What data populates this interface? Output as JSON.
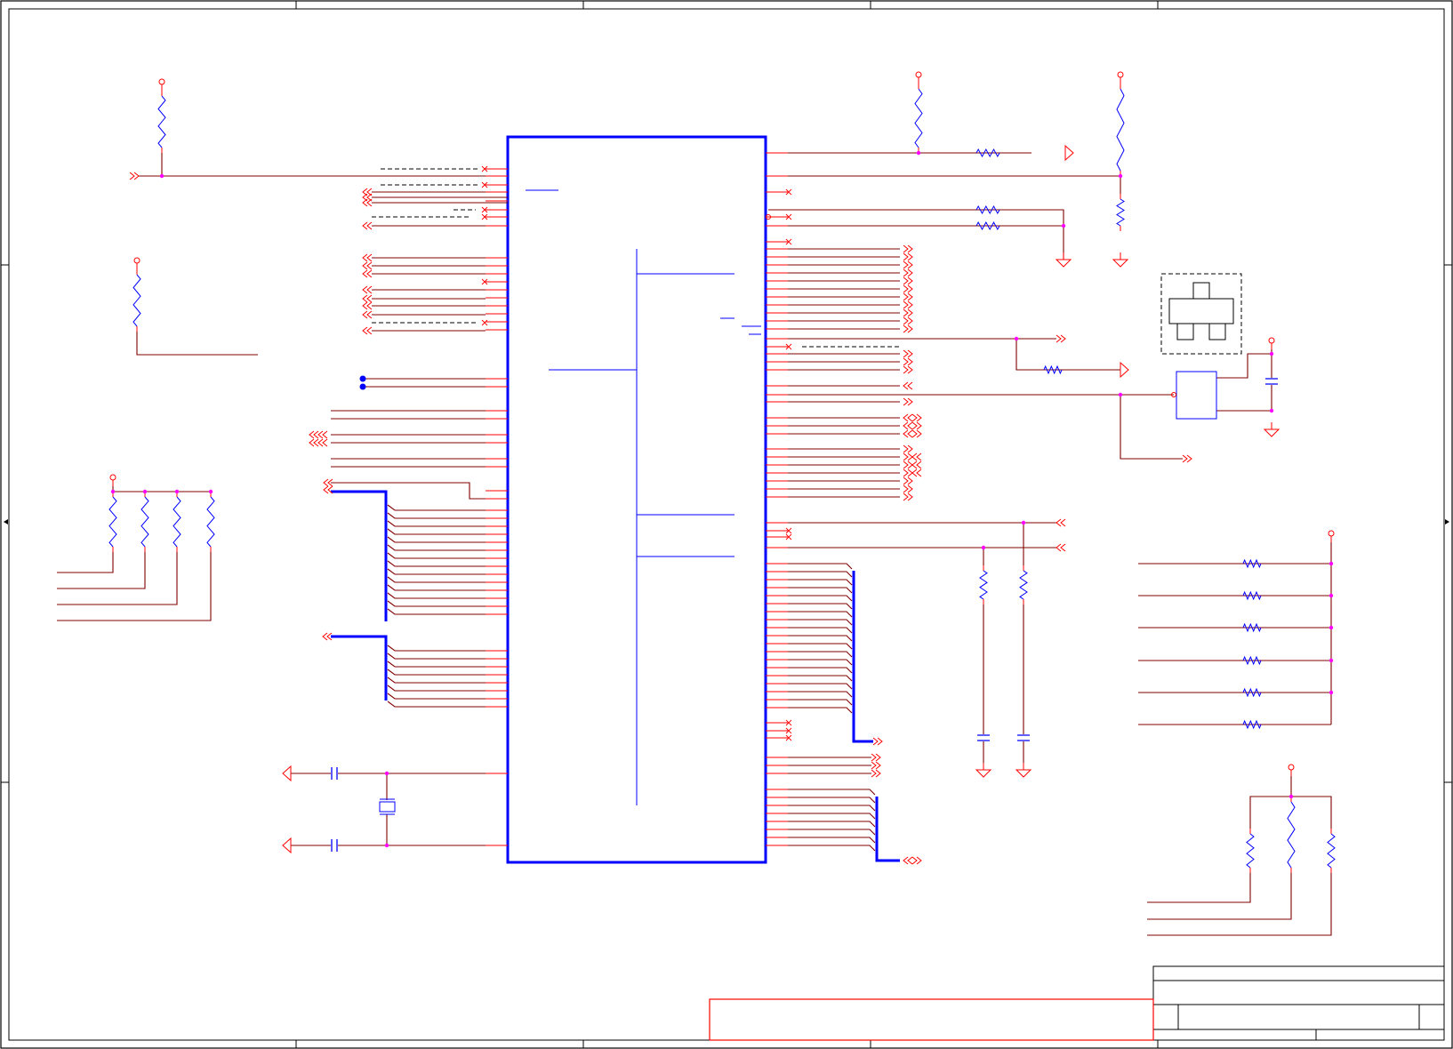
{
  "document": {
    "type": "schematic-sheet",
    "text_labels": []
  },
  "colors": {
    "frame": "#000000",
    "wire": "#800000",
    "pin": "#ff0000",
    "component": "#0000ff",
    "junction": "#ff00ff",
    "title_block_highlight": "#ff0000"
  },
  "symbols": {
    "resistor": "resistor-symbol",
    "capacitor": "capacitor-symbol",
    "crystal": "crystal-symbol",
    "power_port": "power-port-symbol",
    "ground": "ground-symbol",
    "off_page_connector": "off-page-connector-symbol",
    "no_connect": "no-connect-marker"
  }
}
